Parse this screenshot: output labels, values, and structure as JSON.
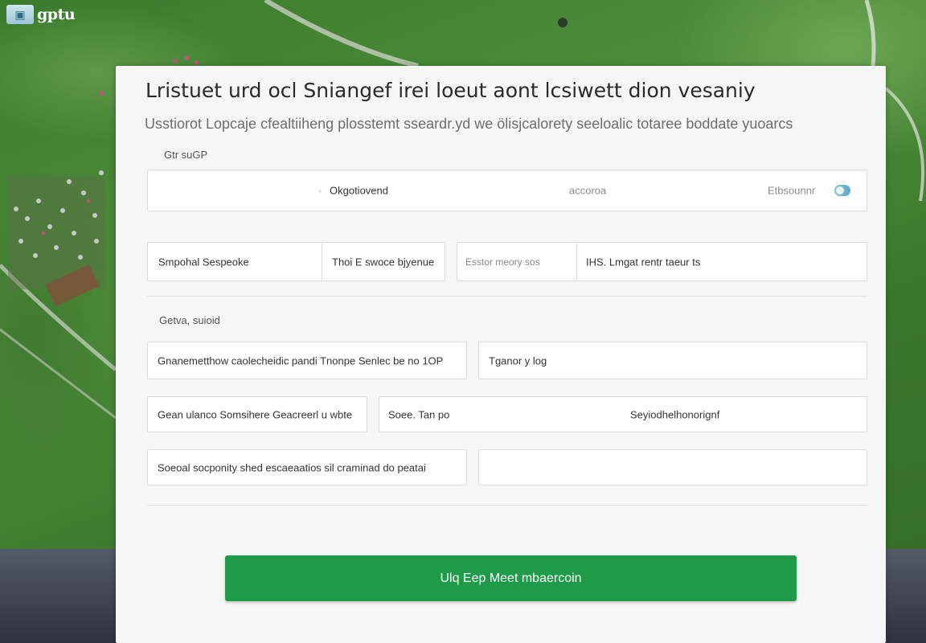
{
  "logo": {
    "text": "gptu",
    "icon": "image-icon"
  },
  "form": {
    "title": "Lristuet urd ocl Sniangef irei loeut aont lcsiwett dion vesaniy",
    "subtitle": "Usstiorot Lopcaje cfealtiiheng plosstemt sseardr.yd we ölisjcalorety seeloalic totaree boddate yuoarcs",
    "section1_label": "Gtr suGP",
    "section2_label": "Getva, suioid",
    "tabs": {
      "option1": "Okgotiovend",
      "option1_prefix": "·",
      "option2": "accoroa",
      "option3": "Etbsounnr"
    },
    "row2": {
      "field1": "Smpohal Sespeoke",
      "field2": "Thoi E swoce bjyenue",
      "field3": "Esstor meory sos",
      "field4": "IHS. Lmgat rentr taeur ts"
    },
    "row3": {
      "field1": "Gnanemetthow caolecheidic pandi   Tnonpe Senlec be no 1OP",
      "field2": "Tganor y log"
    },
    "row4": {
      "field1": "Gean ulanco Somsihere Geacreerl u wbte",
      "field2": "Soee. Tan po",
      "field3": "Seyiodhelhonorignf"
    },
    "row5": {
      "field1": "Soeoal  socponity shed escaeaatios sil craminad  do peatai",
      "field2": ""
    },
    "submit_label": "Ulq Eep Meet mbaercoin"
  },
  "colors": {
    "accent": "#1e9b49",
    "card": "#f6f6f6",
    "bg_green": "#3b7b2d",
    "bg_dark": "#3d4150"
  }
}
